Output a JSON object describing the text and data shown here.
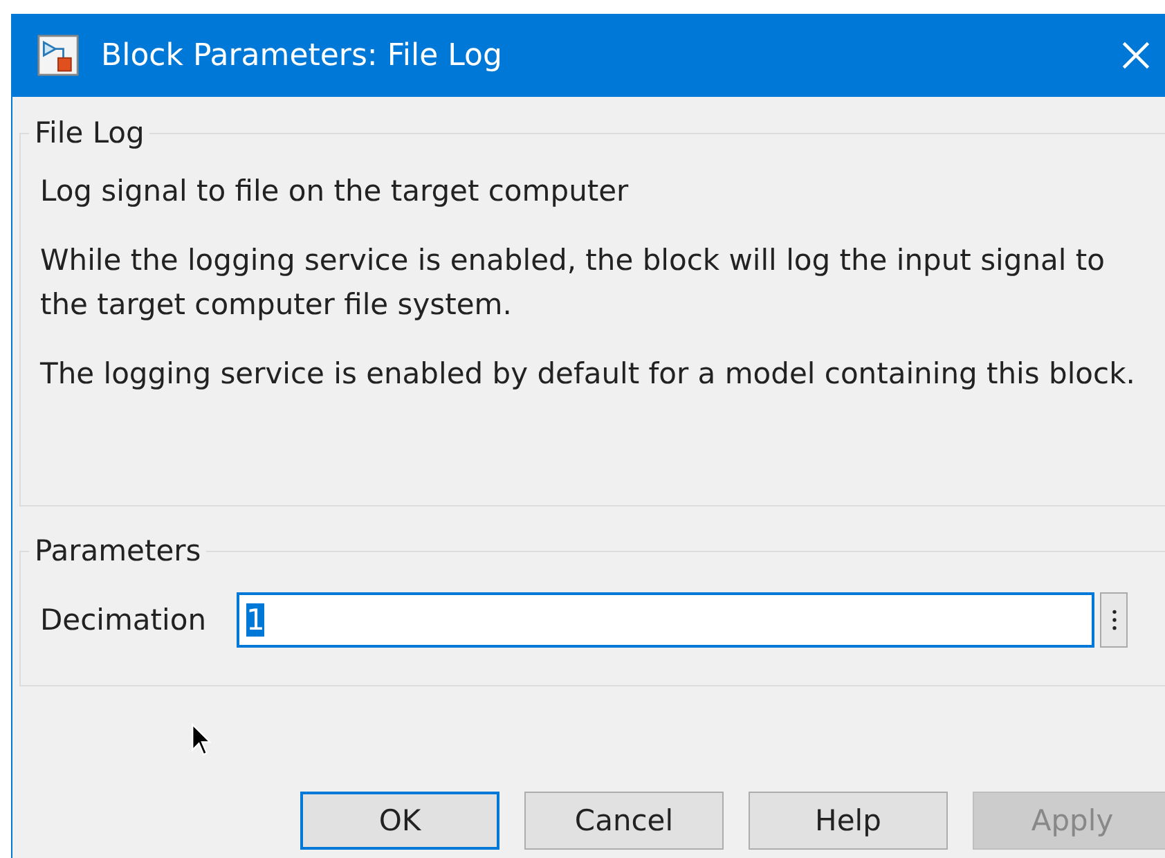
{
  "window": {
    "title": "Block Parameters: File Log"
  },
  "description_group": {
    "title": "File Log",
    "paragraphs": [
      "Log signal to file on the target computer",
      "While the logging service is enabled, the block will log the input signal to the target computer file system.",
      "The logging service is enabled by default for a model containing this block."
    ]
  },
  "parameters_group": {
    "title": "Parameters",
    "fields": [
      {
        "label": "Decimation",
        "value": "1",
        "text_selected": true,
        "focused": true
      }
    ]
  },
  "buttons": [
    {
      "label": "OK",
      "default": true,
      "disabled": false
    },
    {
      "label": "Cancel",
      "default": false,
      "disabled": false
    },
    {
      "label": "Help",
      "default": false,
      "disabled": false
    },
    {
      "label": "Apply",
      "default": false,
      "disabled": true
    }
  ]
}
